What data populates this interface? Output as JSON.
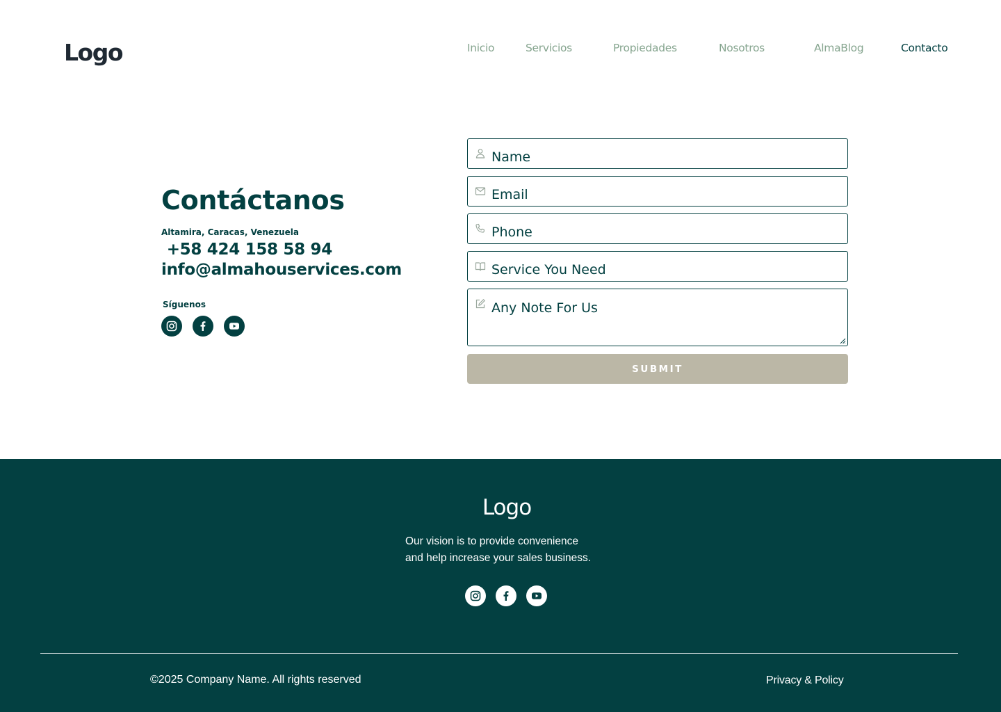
{
  "header": {
    "logo": "Logo",
    "nav": [
      {
        "label": "Inicio"
      },
      {
        "label": "Servicios"
      },
      {
        "label": "Propiedades"
      },
      {
        "label": "Nosotros"
      },
      {
        "label": "AlmaBlog"
      },
      {
        "label": "Contacto",
        "active": true
      }
    ]
  },
  "contact": {
    "title": "Contáctanos",
    "address": "Altamira, Caracas, Venezuela",
    "phone": " +58 424 158 58 94",
    "email": "info@almahouservices.com",
    "follow_label": "Síguenos",
    "social_icons": [
      "instagram-icon",
      "facebook-icon",
      "youtube-icon"
    ]
  },
  "form": {
    "name_placeholder": "Name",
    "email_placeholder": "Email",
    "phone_placeholder": "Phone",
    "service_placeholder": "Service You Need",
    "note_placeholder": "Any Note For Us",
    "field_icons": [
      "user-icon",
      "mail-icon",
      "phone-icon",
      "book-icon",
      "edit-icon"
    ],
    "submit_label": "SUBMIT"
  },
  "footer": {
    "logo": "Logo",
    "vision_line1": "Our vision is to provide convenience",
    "vision_line2": "and help increase your sales business.",
    "copyright": "©2025 Company Name. All rights reserved",
    "privacy": "Privacy & Policy",
    "social_icons": [
      "instagram-icon",
      "facebook-icon",
      "youtube-icon"
    ]
  },
  "colors": {
    "primary": "#034041",
    "nav_muted": "#86a58f",
    "submit_bg": "#bbb7a6",
    "icon_muted": "#9aa89d"
  }
}
